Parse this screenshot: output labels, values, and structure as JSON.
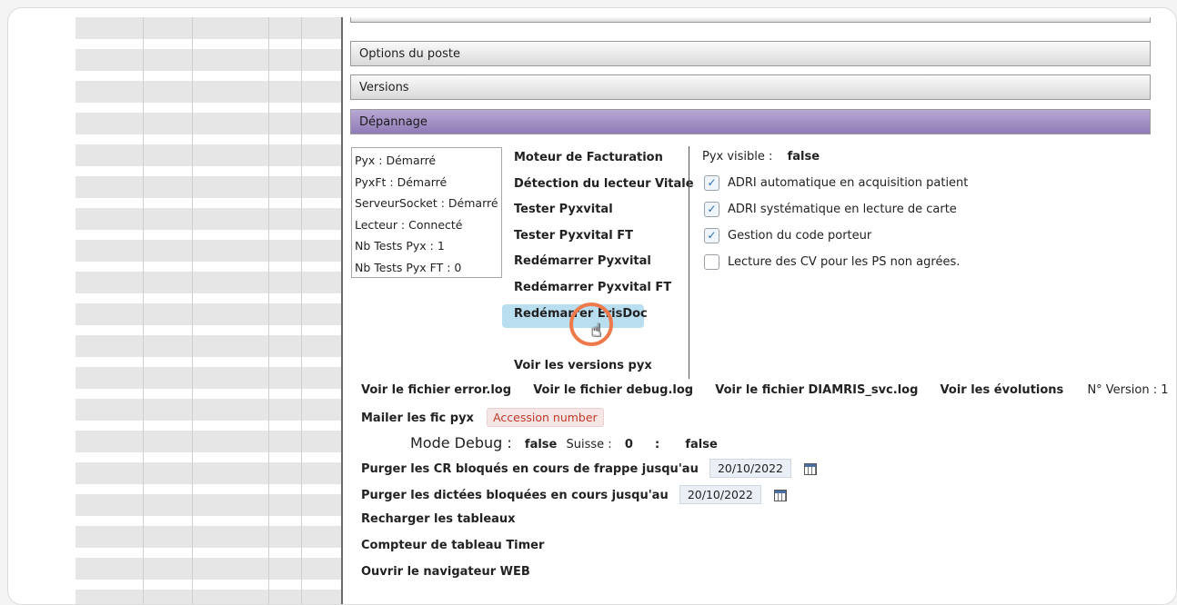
{
  "sections": {
    "options_poste": "Options du poste",
    "versions": "Versions",
    "depannage": "Dépannage"
  },
  "status": [
    "Pyx : Démarré",
    "PyxFt : Démarré",
    "ServeurSocket : Démarré",
    "Lecteur : Connecté",
    "Nb Tests Pyx : 1",
    "Nb Tests Pyx FT : 0"
  ],
  "actions": {
    "moteur": "Moteur de Facturation",
    "detection": "Détection du lecteur Vitale",
    "tester_pyx": "Tester Pyxvital",
    "tester_pyx_ft": "Tester Pyxvital FT",
    "redemarrer_pyx": "Redémarrer Pyxvital",
    "redemarrer_pyx_ft": "Redémarrer Pyxvital FT",
    "redemarrer_erisdoc": "Redémarrer ErisDoc",
    "voir_versions": "Voir les versions pyx"
  },
  "settings": {
    "pyx_visible_label": "Pyx visible :",
    "pyx_visible_value": "false",
    "checkboxes": [
      {
        "label": "ADRI automatique en acquisition patient",
        "checked": true
      },
      {
        "label": "ADRI systématique en lecture de carte",
        "checked": true
      },
      {
        "label": "Gestion du code porteur",
        "checked": true
      },
      {
        "label": "Lecture des CV pour les PS non agrées.",
        "checked": false
      }
    ]
  },
  "logs": {
    "error_log": "Voir le fichier error.log",
    "debug_log": "Voir le fichier debug.log",
    "diamris_log": "Voir le fichier DIAMRIS_svc.log",
    "evolutions": "Voir les évolutions",
    "version_label": "N° Version : 1"
  },
  "mail": {
    "label": "Mailer les fic pyx",
    "badge": "Accession number"
  },
  "debug": {
    "mode_label": "Mode Debug :",
    "mode_value": "false",
    "suisse_label": "Suisse :",
    "suisse_value": "0",
    "colon": ":",
    "extra_value": "false"
  },
  "purge": {
    "cr_label": "Purger les CR bloqués en cours de frappe jusqu'au",
    "cr_date": "20/10/2022",
    "dictees_label": "Purger les dictées bloquées en cours jusqu'au",
    "dictees_date": "20/10/2022"
  },
  "misc": {
    "recharger": "Recharger les tableaux",
    "compteur": "Compteur de tableau Timer",
    "navigateur": "Ouvrir le navigateur WEB"
  },
  "icons": {
    "checkbox_checked": "checkmark-icon",
    "calendar": "calendar-icon",
    "cursor": "hand-pointer-icon"
  },
  "colors": {
    "active_header": "#8f7bb6",
    "highlight": "#b9def0",
    "cursor_ring": "#ee7a4c",
    "badge_text": "#c0392b"
  }
}
